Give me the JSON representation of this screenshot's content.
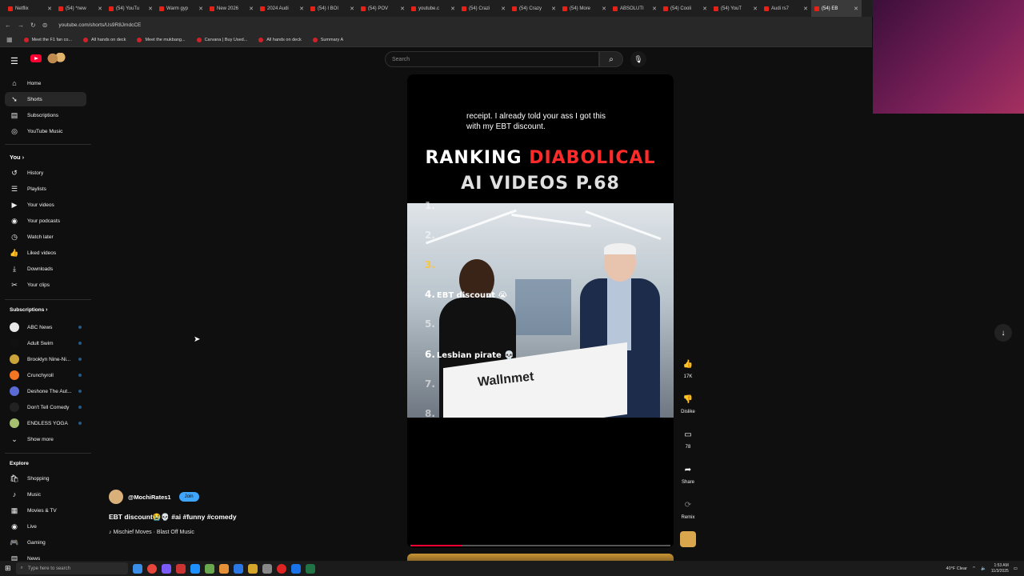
{
  "browser": {
    "tabs": [
      {
        "label": "Netflix"
      },
      {
        "label": "(54) *new"
      },
      {
        "label": "(54) YouTu"
      },
      {
        "label": "Warm gyp"
      },
      {
        "label": "New 2026"
      },
      {
        "label": "2024 Audi"
      },
      {
        "label": "(54) I BOI"
      },
      {
        "label": "(54) POV"
      },
      {
        "label": "youtube.c"
      },
      {
        "label": "(54) Crazi"
      },
      {
        "label": "(54) Crazy"
      },
      {
        "label": "(54) More"
      },
      {
        "label": "ABSOLUTI"
      },
      {
        "label": "(54) Cooli"
      },
      {
        "label": "(54) YouT"
      },
      {
        "label": "Audi rs7"
      },
      {
        "label": "(54) EB"
      }
    ],
    "url": "youtube.com/shorts/Us9R8JmdcCE",
    "bookmarks": [
      {
        "label": "Meet the F1 fan co..."
      },
      {
        "label": "All hands on deck"
      },
      {
        "label": "Meet the mukbang..."
      },
      {
        "label": "Carvana | Buy Used..."
      },
      {
        "label": "All hands on deck"
      },
      {
        "label": "Summary A"
      }
    ]
  },
  "header": {
    "search_placeholder": "Search"
  },
  "sidebar": {
    "main": [
      {
        "label": "Home",
        "icon": "home-icon"
      },
      {
        "label": "Shorts",
        "icon": "shorts-icon"
      },
      {
        "label": "Subscriptions",
        "icon": "subscriptions-icon"
      },
      {
        "label": "YouTube Music",
        "icon": "music-icon"
      }
    ],
    "you_heading": "You",
    "you": [
      {
        "label": "History"
      },
      {
        "label": "Playlists"
      },
      {
        "label": "Your videos"
      },
      {
        "label": "Your podcasts"
      },
      {
        "label": "Watch later"
      },
      {
        "label": "Liked videos"
      },
      {
        "label": "Downloads"
      },
      {
        "label": "Your clips"
      }
    ],
    "subs_heading": "Subscriptions",
    "subs": [
      {
        "label": "ABC News",
        "color": "#e9e9e9"
      },
      {
        "label": "Adult Swim",
        "color": "#111111"
      },
      {
        "label": "Brooklyn Nine-Ni...",
        "color": "#caa33a"
      },
      {
        "label": "Crunchyroll",
        "color": "#f47521"
      },
      {
        "label": "Deshone The Aut...",
        "color": "#5a6bd6"
      },
      {
        "label": "Don't Tell Comedy",
        "color": "#222222"
      },
      {
        "label": "ENDLESS YOGA",
        "color": "#a7c070"
      }
    ],
    "show_more": "Show more",
    "explore_heading": "Explore",
    "explore": [
      {
        "label": "Shopping"
      },
      {
        "label": "Music"
      },
      {
        "label": "Movies & TV"
      },
      {
        "label": "Live"
      },
      {
        "label": "Gaming"
      },
      {
        "label": "News"
      }
    ]
  },
  "video": {
    "caption": "receipt. I already told your ass I got this with my EBT discount.",
    "ranking_line1_white": "RANKING ",
    "ranking_line1_red": "DIABOLICAL",
    "ranking_line2": "AI VIDEOS P.68",
    "rank_items": [
      {
        "num": "1.",
        "label": ""
      },
      {
        "num": "2.",
        "label": ""
      },
      {
        "num": "3.",
        "label": ""
      },
      {
        "num": "4.",
        "label": "EBT discount 😭"
      },
      {
        "num": "5.",
        "label": ""
      },
      {
        "num": "6.",
        "label": "Lesbian pirate 💀"
      },
      {
        "num": "7.",
        "label": ""
      },
      {
        "num": "8.",
        "label": ""
      }
    ],
    "box_text": "Wallnmet",
    "progress": 0.2,
    "accent": "#ff0033"
  },
  "actions": {
    "like_count": "17K",
    "dislike_label": "Dislike",
    "comment_count": "78",
    "share_label": "Share",
    "remix_label": "Remix"
  },
  "meta": {
    "channel": "@MochiRates1",
    "join": "Join",
    "title": "EBT discount😭💀 #ai #funny #comedy",
    "music": "♪ Mischief Moves · Blast Off Music"
  },
  "taskbar": {
    "search_placeholder": "Type here to search",
    "weather": "40°F Clear",
    "time": "1:53 AM",
    "date": "11/3/2025"
  }
}
